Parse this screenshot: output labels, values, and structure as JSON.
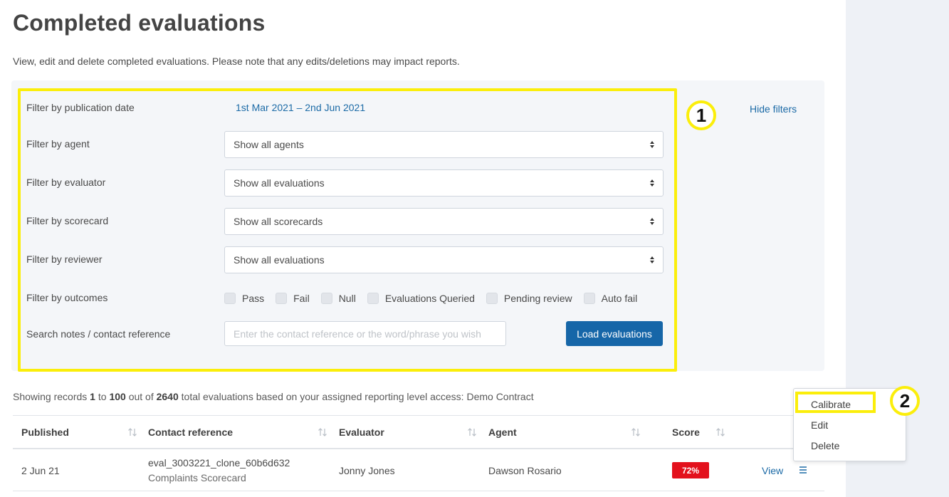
{
  "page": {
    "title": "Completed evaluations",
    "description": "View, edit and delete completed evaluations. Please note that any edits/deletions may impact reports."
  },
  "filters": {
    "publication_date_label": "Filter by publication date",
    "publication_date_value": "1st Mar 2021 – 2nd Jun 2021",
    "agent_label": "Filter by agent",
    "agent_value": "Show all agents",
    "evaluator_label": "Filter by evaluator",
    "evaluator_value": "Show all evaluations",
    "scorecard_label": "Filter by scorecard",
    "scorecard_value": "Show all scorecards",
    "reviewer_label": "Filter by reviewer",
    "reviewer_value": "Show all evaluations",
    "outcomes_label": "Filter by outcomes",
    "outcomes": [
      "Pass",
      "Fail",
      "Null",
      "Evaluations Queried",
      "Pending review",
      "Auto fail"
    ],
    "search_label": "Search notes / contact reference",
    "search_placeholder": "Enter the contact reference or the word/phrase you wish",
    "load_button": "Load evaluations",
    "hide_filters": "Hide filters"
  },
  "annotations": {
    "badge_1": "1",
    "badge_2": "2",
    "highlight_color": "#fbee0b"
  },
  "records": {
    "prefix": "Showing records",
    "from": "1",
    "to_word": "to",
    "to": "100",
    "out_of_word": "out of",
    "total": "2640",
    "suffix": "total evaluations based on your assigned reporting level access: Demo Contract"
  },
  "table": {
    "headers": [
      "Published",
      "Contact reference",
      "Evaluator",
      "Agent",
      "Score"
    ],
    "rows": [
      {
        "published": "2 Jun 21",
        "contact_reference": "eval_3003221_clone_60b6d632",
        "scorecard": "Complaints Scorecard",
        "evaluator": "Jonny Jones",
        "agent": "Dawson Rosario",
        "score": "72%",
        "score_color": "#e3111c",
        "view_label": "View"
      }
    ]
  },
  "row_menu": {
    "items": [
      "Calibrate",
      "Edit",
      "Delete"
    ]
  },
  "colors": {
    "primary": "#1666a8",
    "link": "#1b6aa6",
    "panel_bg": "#f4f6f9",
    "sidebar_bg": "#eef1f6"
  }
}
